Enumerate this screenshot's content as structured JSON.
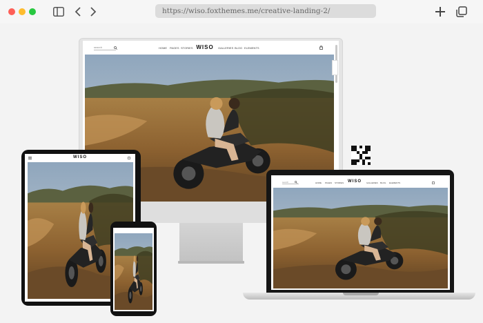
{
  "browser": {
    "url": "https://wiso.foxthemes.me/creative-landing-2/",
    "icons": [
      "sidebar-icon",
      "chevron-left-icon",
      "chevron-right-icon",
      "plus-icon",
      "tabs-icon"
    ]
  },
  "website": {
    "logo": "WISO",
    "search_label": "search",
    "nav_left": [
      "HOME",
      "PAGES",
      "STORIES"
    ],
    "nav_right": [
      "GALLERIES",
      "BLOG",
      "ELEMENTS"
    ],
    "hero_image": "couple riding a motorcycle through golden hills"
  },
  "colors": {
    "traffic_red": "#fe5f57",
    "traffic_yellow": "#febc2e",
    "traffic_green": "#28c840"
  }
}
